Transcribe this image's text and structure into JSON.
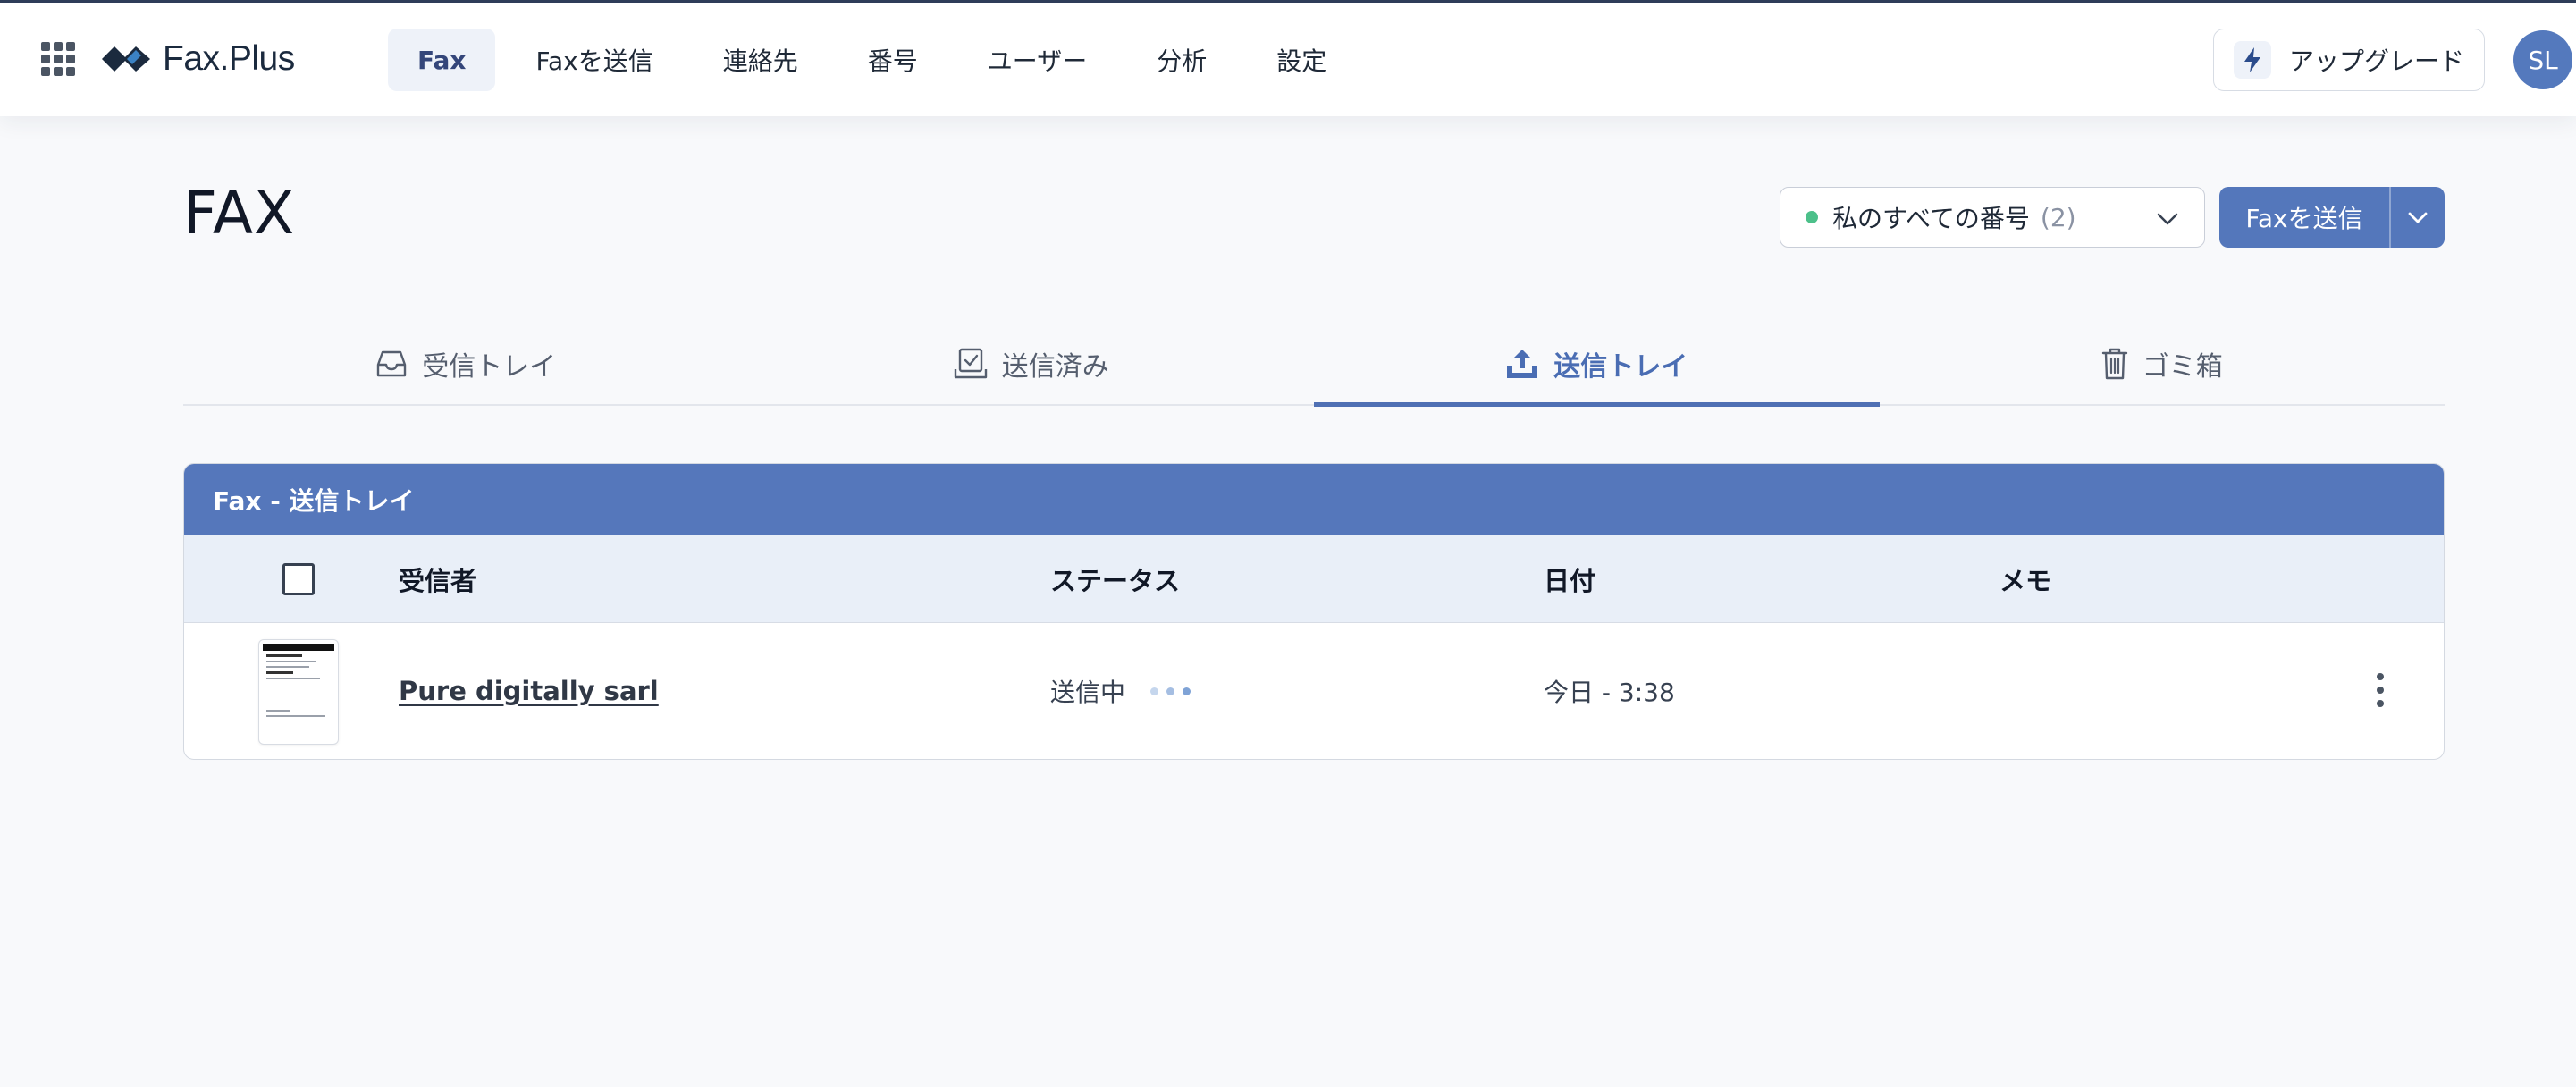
{
  "app": {
    "logo_text": "Fax.Plus"
  },
  "nav": {
    "items": [
      {
        "label": "Fax",
        "active": true
      },
      {
        "label": "Faxを送信",
        "active": false
      },
      {
        "label": "連絡先",
        "active": false
      },
      {
        "label": "番号",
        "active": false
      },
      {
        "label": "ユーザー",
        "active": false
      },
      {
        "label": "分析",
        "active": false
      },
      {
        "label": "設定",
        "active": false
      }
    ]
  },
  "header": {
    "upgrade_label": "アップグレード",
    "avatar_initials": "SL"
  },
  "page": {
    "title": "FAX"
  },
  "number_select": {
    "label": "私のすべての番号",
    "count": "(2)"
  },
  "send_button": {
    "label": "Faxを送信"
  },
  "tabs": [
    {
      "label": "受信トレイ",
      "icon": "inbox-icon",
      "active": false
    },
    {
      "label": "送信済み",
      "icon": "sent-check-icon",
      "active": false
    },
    {
      "label": "送信トレイ",
      "icon": "upload-icon",
      "active": true
    },
    {
      "label": "ゴミ箱",
      "icon": "trash-icon",
      "active": false
    }
  ],
  "table": {
    "title": "Fax - 送信トレイ",
    "columns": {
      "recipient": "受信者",
      "status": "ステータス",
      "date": "日付",
      "memo": "メモ"
    },
    "rows": [
      {
        "recipient": "Pure digitally sarl",
        "status": "送信中",
        "date": "今日 - 3:38",
        "memo": ""
      }
    ]
  },
  "colors": {
    "accent": "#5477bb",
    "active_tab": "#4a6db3",
    "status_dot_green": "#4cc08a",
    "page_bg": "#f8f9fb"
  }
}
